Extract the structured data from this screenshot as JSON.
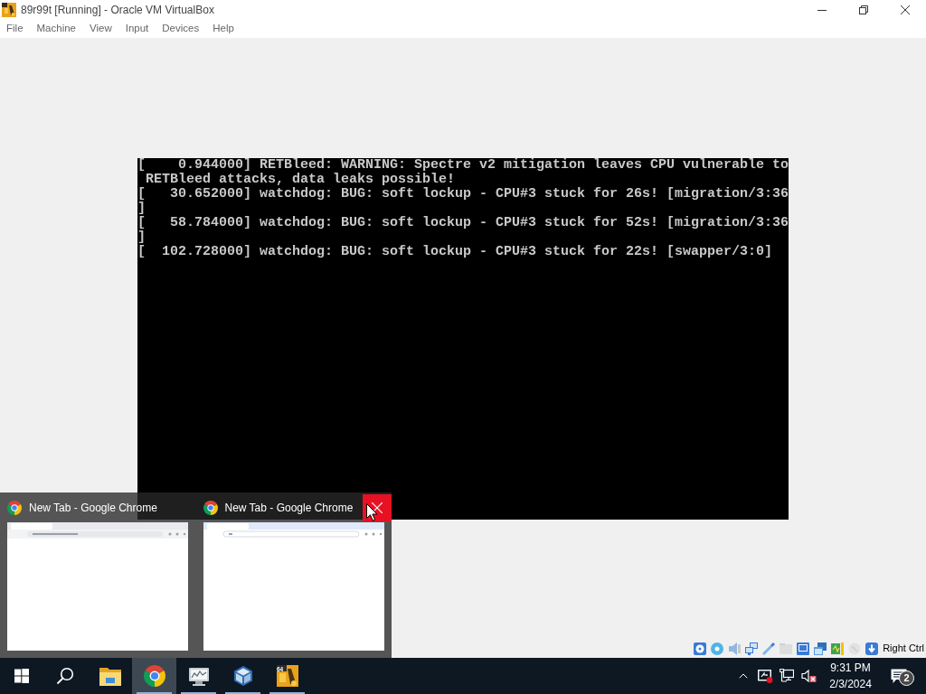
{
  "window": {
    "title": "89r99t [Running] - Oracle VM VirtualBox"
  },
  "menu": [
    "File",
    "Machine",
    "View",
    "Input",
    "Devices",
    "Help"
  ],
  "console": {
    "lines": [
      "[    0.944000] RETBleed: WARNING: Spectre v2 mitigation leaves CPU vulnerable to",
      " RETBleed attacks, data leaks possible!",
      "[   30.652000] watchdog: BUG: soft lockup - CPU#3 stuck for 26s! [migration/3:36",
      "]",
      "[   58.784000] watchdog: BUG: soft lockup - CPU#3 stuck for 52s! [migration/3:36",
      "]",
      "[  102.728000] watchdog: BUG: soft lockup - CPU#3 stuck for 22s! [swapper/3:0]"
    ]
  },
  "status_bar": {
    "host_key": "Right Ctrl"
  },
  "previews": [
    {
      "title": "New Tab - Google Chrome",
      "hovered": false
    },
    {
      "title": "New Tab - Google Chrome",
      "hovered": true
    }
  ],
  "taskbar": {
    "apps": [
      {
        "running": false,
        "selected": false
      },
      {
        "running": true,
        "selected": true
      },
      {
        "running": true,
        "selected": false
      },
      {
        "running": true,
        "selected": false
      },
      {
        "running": true,
        "selected": false,
        "icon_text": "64"
      }
    ],
    "tray": {
      "alert": true,
      "muted": true,
      "time": "9:31 PM",
      "date": "2/3/2024",
      "notifications": "2"
    }
  }
}
